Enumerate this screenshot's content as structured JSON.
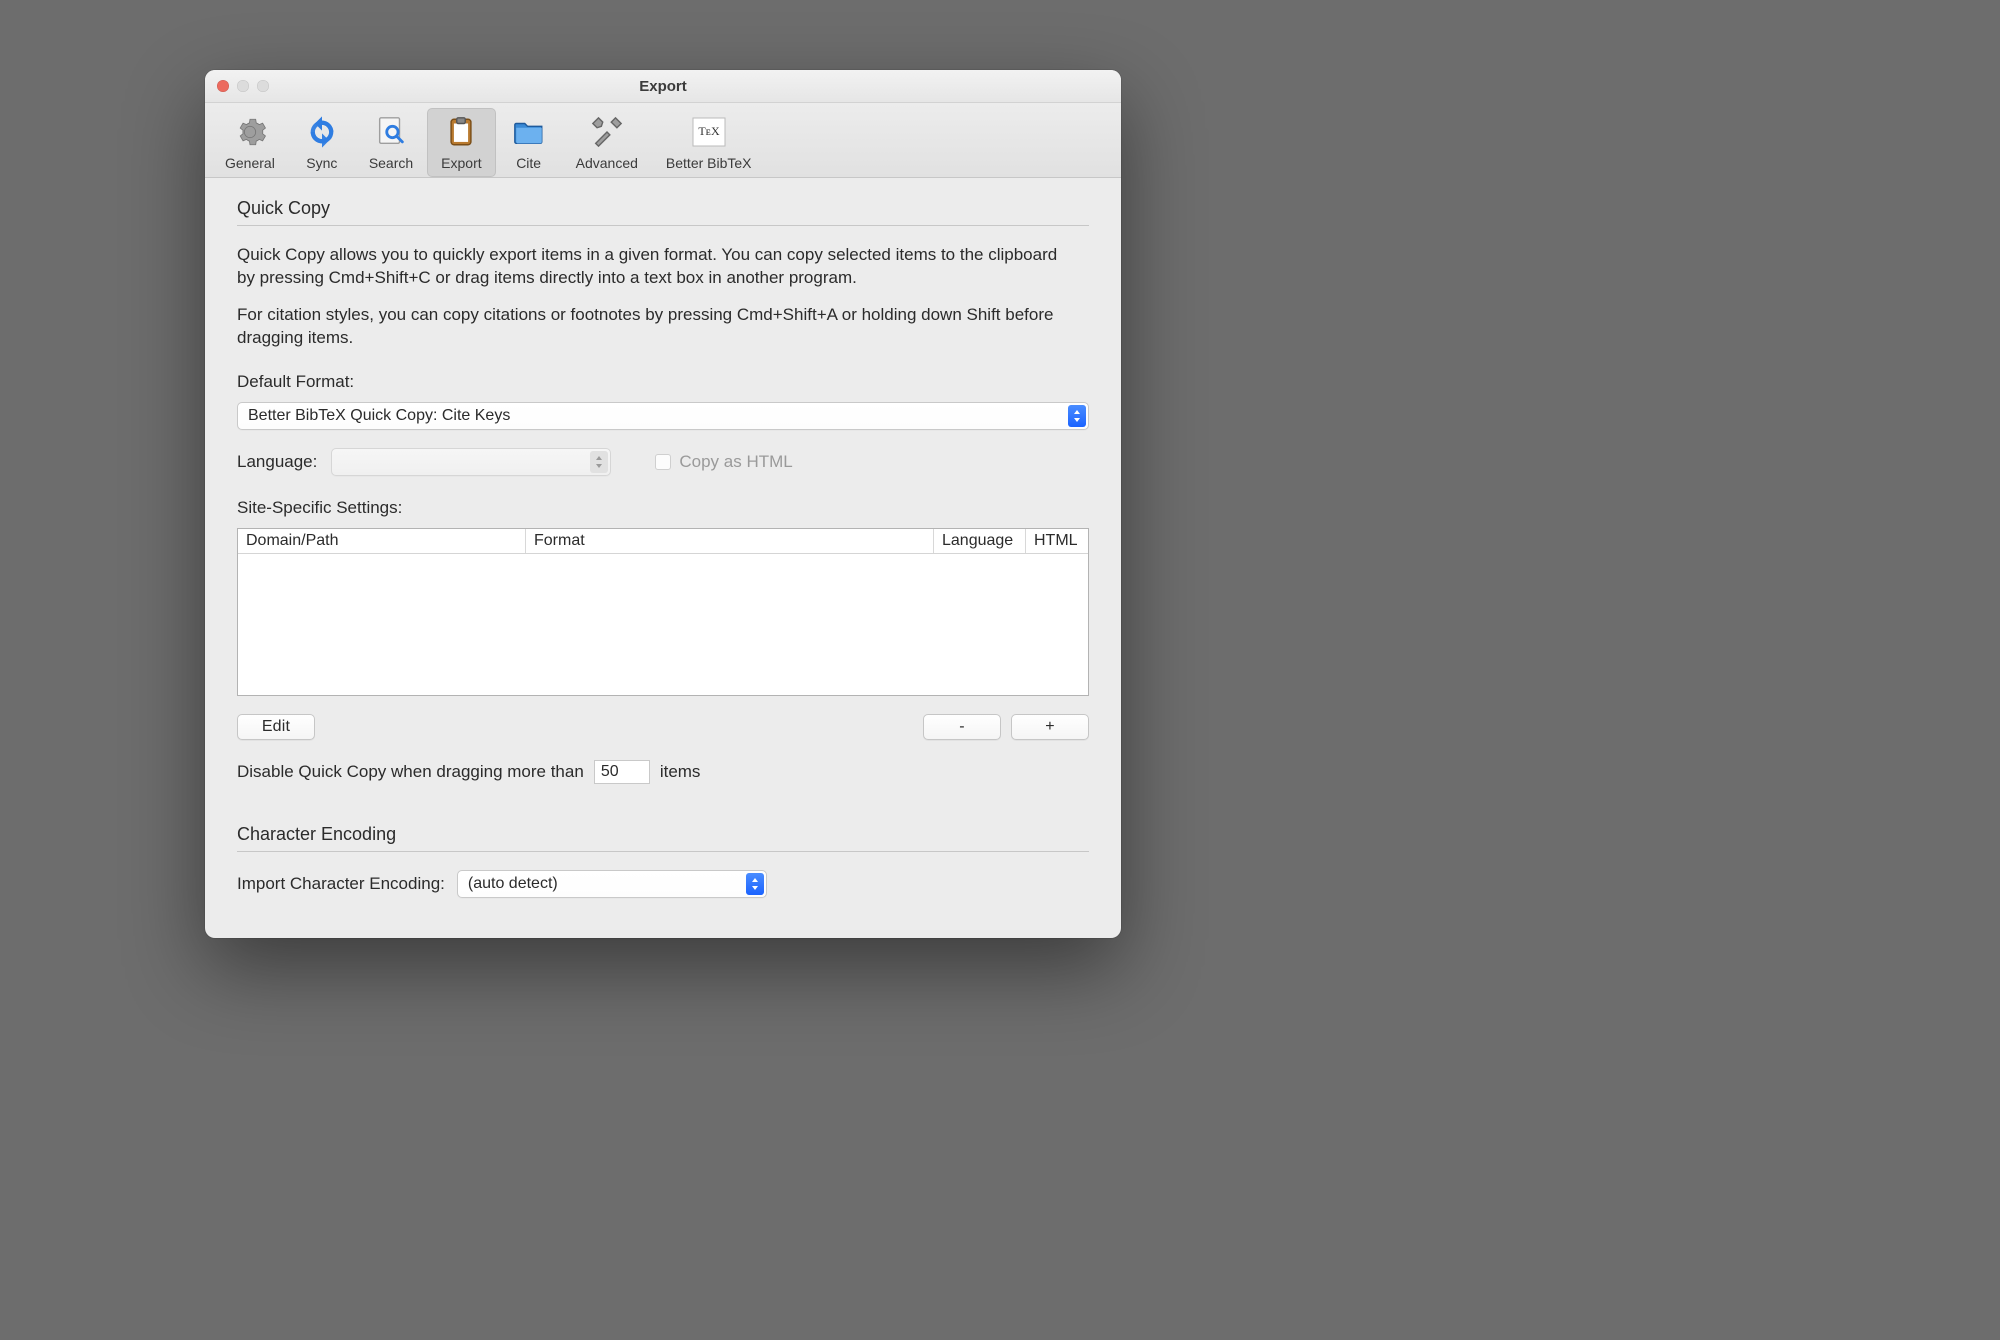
{
  "window": {
    "title": "Export"
  },
  "toolbar": {
    "items": [
      {
        "label": "General"
      },
      {
        "label": "Sync"
      },
      {
        "label": "Search"
      },
      {
        "label": "Export"
      },
      {
        "label": "Cite"
      },
      {
        "label": "Advanced"
      },
      {
        "label": "Better BibTeX"
      }
    ]
  },
  "quickcopy": {
    "title": "Quick Copy",
    "desc1": "Quick Copy allows you to quickly export items in a given format. You can copy selected items to the clipboard by pressing Cmd+Shift+C or drag items directly into a text box in another program.",
    "desc2": "For citation styles, you can copy citations or footnotes by pressing Cmd+Shift+A or holding down Shift before dragging items.",
    "default_format_label": "Default Format:",
    "default_format_value": "Better BibTeX Quick Copy: Cite Keys",
    "language_label": "Language:",
    "language_value": "",
    "copy_as_html_label": "Copy as HTML",
    "site_specific_label": "Site-Specific Settings:",
    "table_headers": {
      "domain": "Domain/Path",
      "format": "Format",
      "language": "Language",
      "html": "HTML"
    },
    "edit_label": "Edit",
    "remove_label": "-",
    "add_label": "+",
    "disable_prefix": "Disable Quick Copy when dragging more than",
    "disable_value": "50",
    "disable_suffix": "items"
  },
  "encoding": {
    "title": "Character Encoding",
    "import_label": "Import Character Encoding:",
    "import_value": "(auto detect)"
  }
}
